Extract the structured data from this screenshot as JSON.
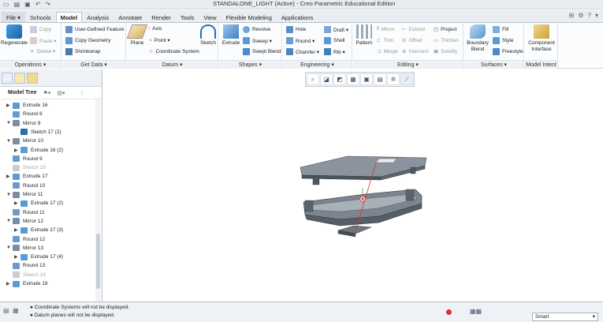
{
  "window": {
    "title": "STANDALONE_LIGHT (Active) - Creo Parametric Educational Edition"
  },
  "tabs": [
    "File ▾",
    "Schools",
    "Model",
    "Analysis",
    "Annotate",
    "Render",
    "Tools",
    "View",
    "Flexible Modeling",
    "Applications"
  ],
  "ribbon": {
    "operations": {
      "label": "Operations ▾",
      "regenerate": "Regenerate",
      "copy": "Copy",
      "paste": "Paste ▾",
      "delete": "Delete ▾"
    },
    "getdata": {
      "label": "Get Data ▾",
      "udf": "User-Defined Feature",
      "copygeom": "Copy Geometry",
      "shrinkwrap": "Shrinkwrap"
    },
    "datum": {
      "label": "Datum ▾",
      "plane": "Plane",
      "axis": "Axis",
      "point": "Point ▾",
      "coordsys": "Coordinate System",
      "sketch": "Sketch"
    },
    "shapes": {
      "label": "Shapes ▾",
      "extrude": "Extrude",
      "revolve": "Revolve",
      "sweep": "Sweep ▾",
      "sweptblend": "Swept Blend"
    },
    "engineering": {
      "label": "Engineering ▾",
      "hole": "Hole",
      "round": "Round ▾",
      "chamfer": "Chamfer ▾",
      "draft": "Draft ▾",
      "shell": "Shell",
      "rib": "Rib ▾"
    },
    "editing": {
      "label": "Editing ▾",
      "pattern": "Pattern",
      "mirror": "Mirror",
      "trim": "Trim",
      "merge": "Merge",
      "extend": "Extend",
      "offset": "Offset",
      "intersect": "Intersect",
      "project": "Project",
      "thicken": "Thicken",
      "solidify": "Solidify"
    },
    "surfaces": {
      "label": "Surfaces ▾",
      "boundary": "Boundary Blend",
      "fill": "Fill",
      "style": "Style",
      "freestyle": "Freestyle"
    },
    "intent": {
      "label": "Model Intent ▾",
      "component": "Component Interface"
    }
  },
  "tree": {
    "header": "Model Tree",
    "items": [
      {
        "label": "Extrude 16",
        "arrow": "▶",
        "indent": 0,
        "dim": false
      },
      {
        "label": "Round 8",
        "arrow": "",
        "indent": 0,
        "dim": false
      },
      {
        "label": "Mirror 9",
        "arrow": "▼",
        "indent": 0,
        "dim": false
      },
      {
        "label": "Sketch 17 (2)",
        "arrow": "",
        "indent": 1,
        "dim": false
      },
      {
        "label": "Mirror 10",
        "arrow": "▼",
        "indent": 0,
        "dim": false
      },
      {
        "label": "Extrude 16 (2)",
        "arrow": "▶",
        "indent": 1,
        "dim": false
      },
      {
        "label": "Round 9",
        "arrow": "",
        "indent": 0,
        "dim": false
      },
      {
        "label": "Sketch 18",
        "arrow": "",
        "indent": 0,
        "dim": true
      },
      {
        "label": "Extrude 17",
        "arrow": "▶",
        "indent": 0,
        "dim": false
      },
      {
        "label": "Round 10",
        "arrow": "",
        "indent": 0,
        "dim": false
      },
      {
        "label": "Mirror 11",
        "arrow": "▼",
        "indent": 0,
        "dim": false
      },
      {
        "label": "Extrude 17 (2)",
        "arrow": "▶",
        "indent": 1,
        "dim": false
      },
      {
        "label": "Round 11",
        "arrow": "",
        "indent": 0,
        "dim": false
      },
      {
        "label": "Mirror 12",
        "arrow": "▼",
        "indent": 0,
        "dim": false
      },
      {
        "label": "Extrude 17 (3)",
        "arrow": "▶",
        "indent": 1,
        "dim": false
      },
      {
        "label": "Round 12",
        "arrow": "",
        "indent": 0,
        "dim": false
      },
      {
        "label": "Mirror 13",
        "arrow": "▼",
        "indent": 0,
        "dim": false
      },
      {
        "label": "Extrude 17 (4)",
        "arrow": "▶",
        "indent": 1,
        "dim": false
      },
      {
        "label": "Round 13",
        "arrow": "",
        "indent": 0,
        "dim": false
      },
      {
        "label": "Sketch 19",
        "arrow": "",
        "indent": 0,
        "dim": true
      },
      {
        "label": "Extrude 18",
        "arrow": "▶",
        "indent": 0,
        "dim": false
      }
    ]
  },
  "status": {
    "messages": [
      "Coordinate Systems will not be displayed.",
      "Datum planes will not be displayed."
    ],
    "filter": "Smart"
  },
  "colors": {
    "accent": "#2b6cb0",
    "part": "#5a6470",
    "line": "#e03030"
  }
}
